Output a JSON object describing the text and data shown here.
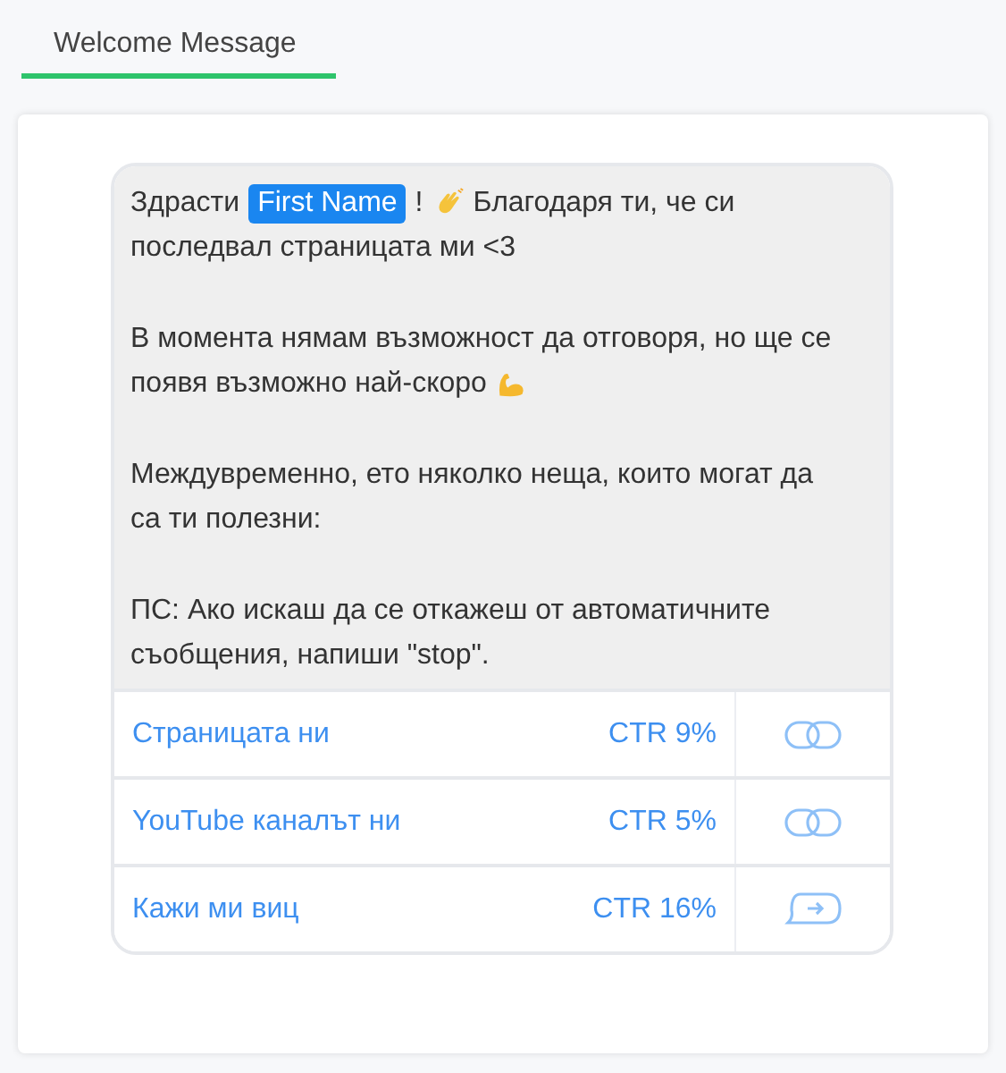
{
  "tabs": [
    {
      "label": "Welcome Message",
      "selected": true
    }
  ],
  "message": {
    "paragraphs": [
      [
        [
          {
            "kind": "text",
            "text": "Здрасти"
          },
          {
            "kind": "tag",
            "text": "First Name"
          },
          {
            "kind": "text",
            "text": "!"
          },
          {
            "kind": "wave"
          },
          {
            "kind": "text",
            "text": "Благодаря ти, че си"
          }
        ],
        [
          {
            "kind": "text",
            "text": "последвал страницата ми <3"
          }
        ]
      ],
      [
        [
          {
            "kind": "text",
            "text": "В момента нямам възможност да отговоря, но ще се"
          }
        ],
        [
          {
            "kind": "text",
            "text": "появя възможно най-скоро"
          },
          {
            "kind": "muscle"
          }
        ]
      ],
      [
        [
          {
            "kind": "text",
            "text": "Междувременно, ето няколко неща, които могат да"
          }
        ],
        [
          {
            "kind": "text",
            "text": "са ти полезни:"
          }
        ]
      ],
      [
        [
          {
            "kind": "text",
            "text": "ПС: Ако искаш да се откажеш от автоматичните"
          }
        ],
        [
          {
            "kind": "text",
            "text": "съобщения, напиши \"stop\"."
          }
        ]
      ]
    ],
    "buttons": [
      {
        "label": "Страницата ни",
        "ctr": "CTR 9%",
        "kind": "link"
      },
      {
        "label": "YouTube каналът ни",
        "ctr": "CTR 5%",
        "kind": "link"
      },
      {
        "label": "Кажи ми виц",
        "ctr": "CTR 16%",
        "kind": "reply"
      }
    ]
  }
}
